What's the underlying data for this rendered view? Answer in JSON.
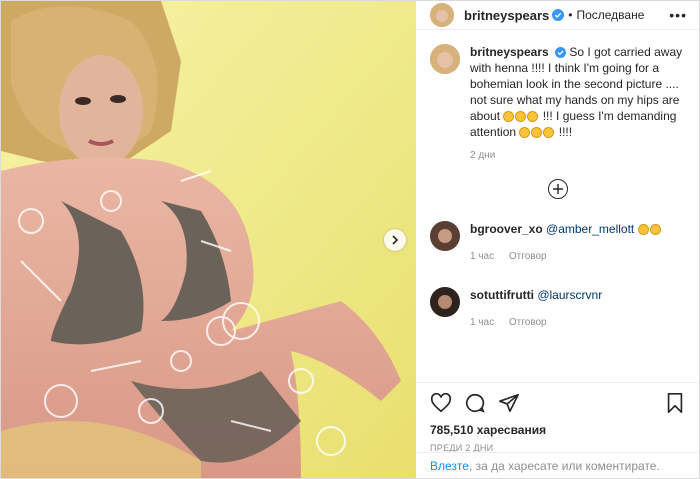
{
  "header": {
    "username": "britneyspears",
    "separator": "•",
    "follow_label": "Последване",
    "more": "•••"
  },
  "caption": {
    "username": "britneyspears",
    "text": "So I got carried away with henna !!!!  I think I'm going for a bohemian look in the second picture .... not sure what my hands on my hips are about",
    "text_after_emoji": "!!! I guess I'm demanding attention",
    "text_end": "!!!!",
    "time": "2 дни"
  },
  "comments": [
    {
      "username": "bgroover_xo",
      "mention": "@amber_mellott",
      "time": "1 час",
      "reply_label": "Отговор"
    },
    {
      "username": "sotuttifrutti",
      "mention": "@laurscrvnr",
      "time": "1 час",
      "reply_label": "Отговор"
    }
  ],
  "actions": {
    "likes": "785,510 харесвания",
    "posted": "ПРЕДИ 2 ДНИ"
  },
  "login": {
    "link": "Влезте",
    "text": ", за да харесате или коментирате."
  },
  "icons": [
    "verified-badge-icon",
    "more-icon",
    "plus-circle-icon",
    "heart-icon",
    "comment-icon",
    "share-icon",
    "bookmark-icon",
    "chevron-right-icon"
  ],
  "colors": {
    "link": "#0095f6",
    "verified": "#3897f0",
    "muted": "#8e8e8e"
  }
}
